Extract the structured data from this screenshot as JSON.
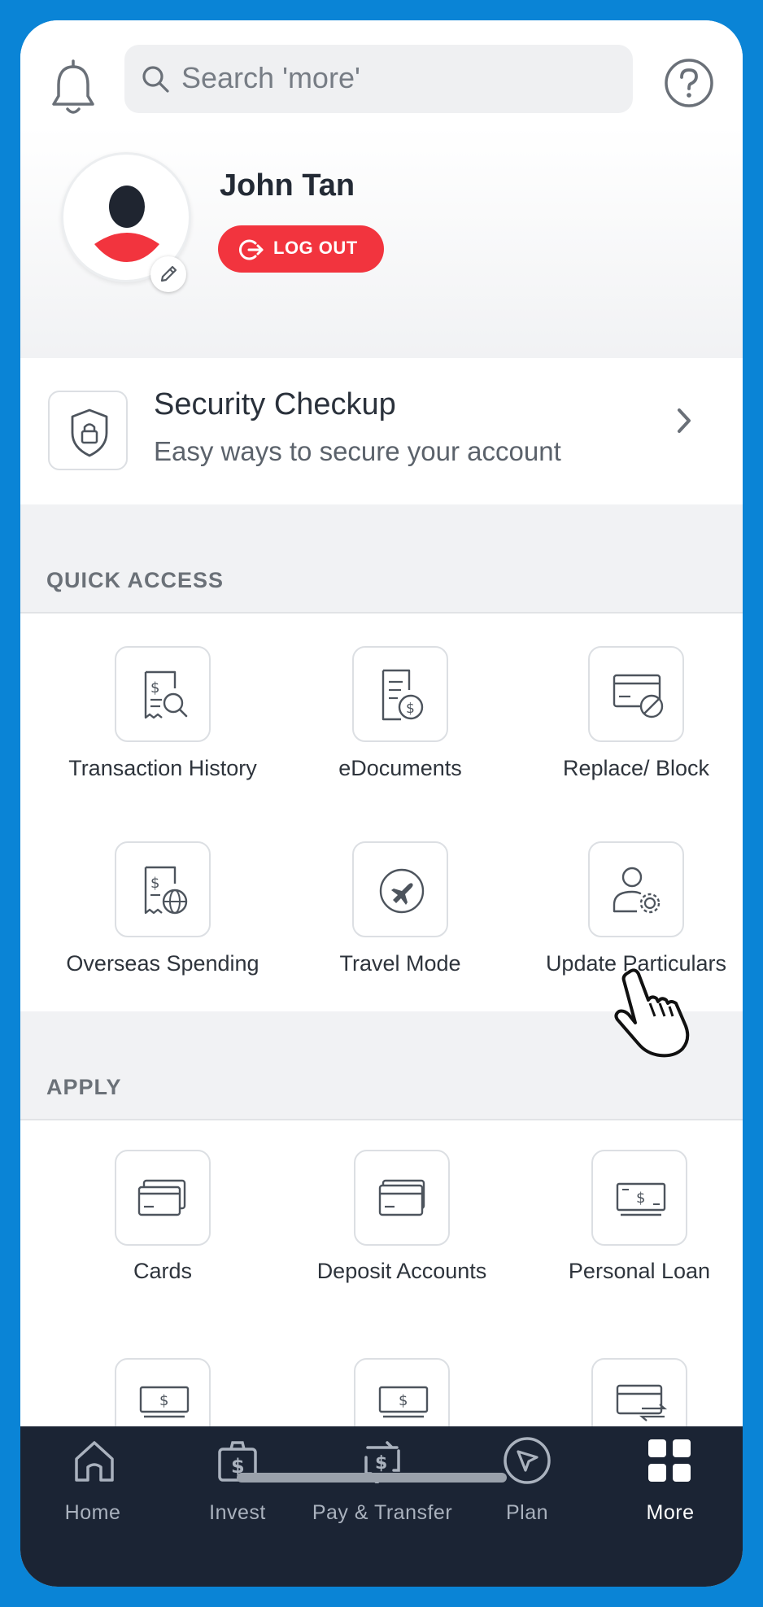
{
  "search": {
    "placeholder": "Search 'more'"
  },
  "profile": {
    "name": "John Tan",
    "logout_label": "LOG OUT"
  },
  "security": {
    "title": "Security Checkup",
    "subtitle": "Easy ways to secure your account"
  },
  "quick_access": {
    "heading": "QUICK ACCESS",
    "items": [
      {
        "label": "Transaction History",
        "icon": "receipt-search-icon"
      },
      {
        "label": "eDocuments",
        "icon": "document-dollar-icon"
      },
      {
        "label": "Replace/ Block",
        "icon": "card-block-icon"
      },
      {
        "label": "Overseas Spending",
        "icon": "receipt-globe-icon"
      },
      {
        "label": "Travel Mode",
        "icon": "airplane-icon"
      },
      {
        "label": "Update Particulars",
        "icon": "user-gear-icon"
      }
    ]
  },
  "apply": {
    "heading": "APPLY",
    "items": [
      {
        "label": "Cards",
        "icon": "cards-icon"
      },
      {
        "label": "Deposit Accounts",
        "icon": "card-icon"
      },
      {
        "label": "Personal Loan",
        "icon": "cash-icon"
      }
    ]
  },
  "nav": {
    "items": [
      {
        "label": "Home",
        "icon": "home-icon"
      },
      {
        "label": "Invest",
        "icon": "invest-bag-icon"
      },
      {
        "label": "Pay & Transfer",
        "icon": "pay-transfer-icon"
      },
      {
        "label": "Plan",
        "icon": "compass-icon"
      },
      {
        "label": "More",
        "icon": "grid-icon"
      }
    ],
    "active": "More"
  },
  "colors": {
    "brand_blue": "#0a84d6",
    "logout_red": "#f2343e",
    "nav_bg": "#1b2434"
  }
}
